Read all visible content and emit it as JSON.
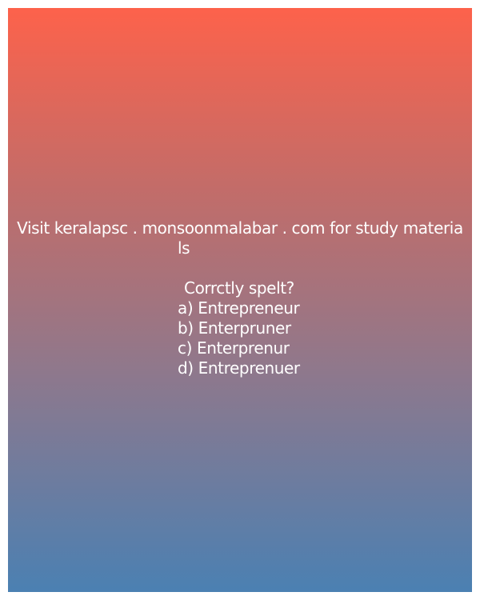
{
  "header": {
    "line1": "Visit keralapsc . monsoonmalabar . com for study materia",
    "line2": "ls"
  },
  "question": "Corrctly spelt?",
  "options": [
    "a) Entrepreneur",
    "b) Enterpruner",
    "c) Enterprenur",
    "d) Entreprenuer"
  ],
  "colors": {
    "gradient_top": "#fd624b",
    "gradient_bottom": "#4b80b2",
    "text": "#ffffff"
  }
}
